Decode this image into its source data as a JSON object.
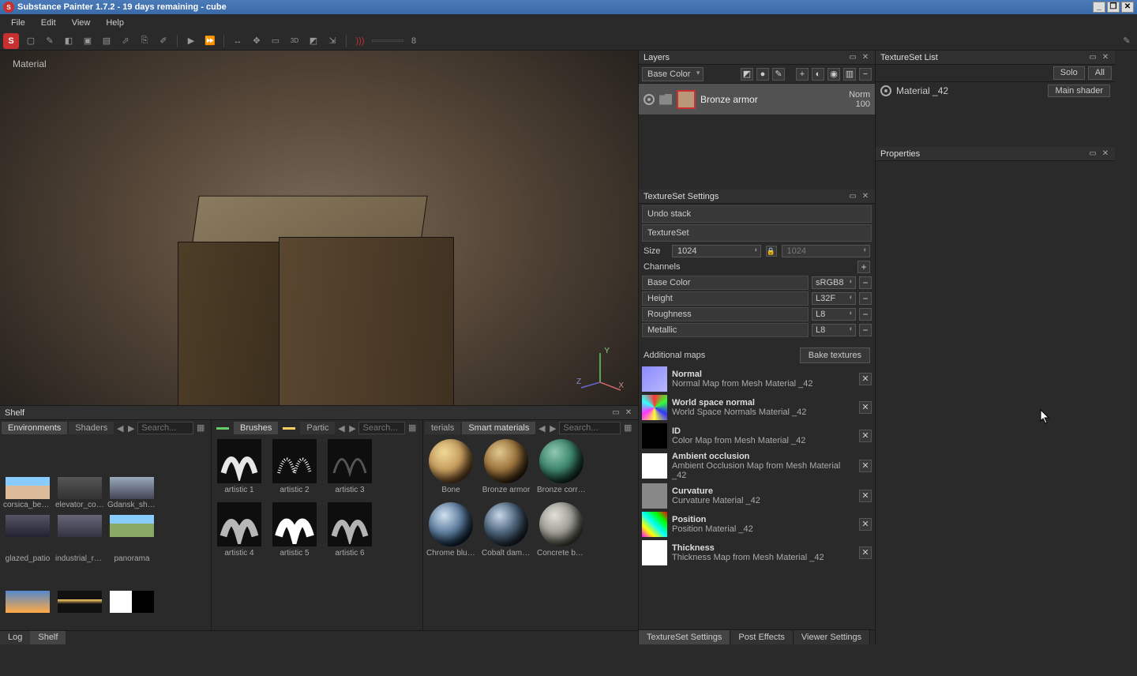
{
  "title": "Substance Painter 1.7.2 - 19 days remaining - cube",
  "menu": [
    "File",
    "Edit",
    "View",
    "Help"
  ],
  "toolbar_num": "8",
  "viewport_label": "Material",
  "axis": {
    "x": "X",
    "y": "Y",
    "z": "Z"
  },
  "layers": {
    "title": "Layers",
    "channel": "Base Color",
    "row": {
      "name": "Bronze armor",
      "blend": "Norm",
      "opacity": "100"
    }
  },
  "ts_settings": {
    "title": "TextureSet Settings",
    "undo": "Undo stack",
    "ts": "TextureSet",
    "size_lbl": "Size",
    "size1": "1024",
    "size2": "1024",
    "channels_lbl": "Channels",
    "channels": [
      {
        "name": "Base Color",
        "fmt": "sRGB8"
      },
      {
        "name": "Height",
        "fmt": "L32F"
      },
      {
        "name": "Roughness",
        "fmt": "L8"
      },
      {
        "name": "Metallic",
        "fmt": "L8"
      }
    ],
    "add_maps_lbl": "Additional maps",
    "bake": "Bake textures",
    "maps": [
      {
        "name": "Normal",
        "sub": "Normal Map from Mesh Material _42",
        "sw": "linear-gradient(135deg,#8a8aff,#b8b8ff)"
      },
      {
        "name": "World space normal",
        "sub": "World Space Normals Material _42",
        "sw": "conic-gradient(#f33,#3f3,#33f,#ff3,#f3f,#3ff,#f33)"
      },
      {
        "name": "ID",
        "sub": "Color Map from Mesh Material _42",
        "sw": "#000"
      },
      {
        "name": "Ambient occlusion",
        "sub": "Ambient Occlusion Map from Mesh Material _42",
        "sw": "#fff"
      },
      {
        "name": "Curvature",
        "sub": "Curvature Material _42",
        "sw": "#888"
      },
      {
        "name": "Position",
        "sub": "Position Material _42",
        "sw": "linear-gradient(45deg,#f0f,#ff0,#0ff,#0f0,#f00)"
      },
      {
        "name": "Thickness",
        "sub": "Thickness Map from Mesh Material _42",
        "sw": "#fff"
      }
    ]
  },
  "tslist": {
    "title": "TextureSet List",
    "solo": "Solo",
    "all": "All",
    "item": "Material _42",
    "shader": "Main shader"
  },
  "props": {
    "title": "Properties"
  },
  "shelf": {
    "title": "Shelf",
    "envs_tab": "Environments",
    "shaders_tab": "Shaders",
    "search": "Search...",
    "envs": [
      "corsica_beach",
      "elevator_corr…",
      "Gdansk_ship…",
      "glazed_patio",
      "industrial_room",
      "panorama"
    ],
    "brushes_tab": "Brushes",
    "particles_tab": "Partic",
    "brushes": [
      "artistic 1",
      "artistic 2",
      "artistic 3",
      "artistic 4",
      "artistic 5",
      "artistic 6"
    ],
    "materials_tab": "terials",
    "smart_tab": "Smart materials",
    "smart": [
      {
        "name": "Bone",
        "hi": "#f0d898",
        "mid": "#c8a060",
        "lo": "#604020"
      },
      {
        "name": "Bronze armor",
        "hi": "#e0c890",
        "mid": "#a07840",
        "lo": "#302010",
        "sel": true
      },
      {
        "name": "Bronze corro…",
        "hi": "#90c8b0",
        "mid": "#408870",
        "lo": "#102820"
      },
      {
        "name": "Chrome blue…",
        "hi": "#d0e0f0",
        "mid": "#6080a0",
        "lo": "#102030"
      },
      {
        "name": "Cobalt dama…",
        "hi": "#c8d8e8",
        "mid": "#506880",
        "lo": "#182028"
      },
      {
        "name": "Concrete bare",
        "hi": "#e0e0d8",
        "mid": "#a0a098",
        "lo": "#404038"
      }
    ]
  },
  "footer_tabs": [
    "Log",
    "Shelf"
  ],
  "bottom_tabs": [
    "TextureSet Settings",
    "Post Effects",
    "Viewer Settings"
  ]
}
